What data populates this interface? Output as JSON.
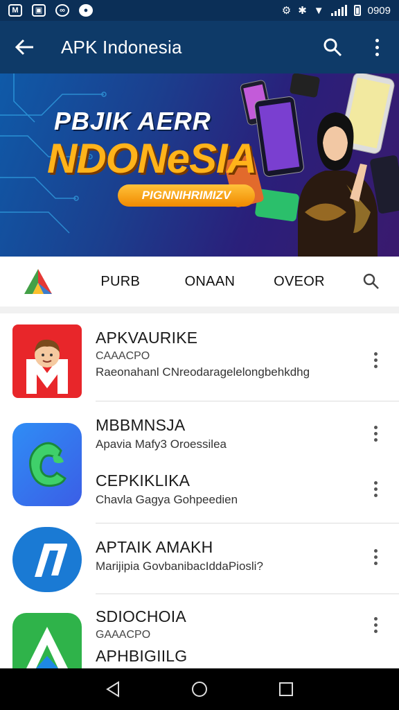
{
  "status_bar": {
    "left_icons": [
      "gmail-icon",
      "sim-icon",
      "message-icon",
      "music-icon"
    ],
    "time": "0909",
    "right_icons": [
      "vibrate-icon",
      "bluetooth-icon",
      "wifi-icon",
      "signal-icon",
      "battery-icon"
    ]
  },
  "app_bar": {
    "title": "APK Indonesia",
    "back_icon": "arrow-left-icon",
    "actions": [
      "search-icon",
      "more-vert-icon"
    ],
    "background": "#0e3a68"
  },
  "banner": {
    "line1": "PBJIK AERR",
    "line2": "NDONeSIA",
    "pill": "PIGNNIHRIMIZV",
    "accent": "#ffb31a"
  },
  "tabs": {
    "items": [
      "PURB",
      "ONAAN",
      "OVEOR"
    ],
    "logo_icon": "play-triangle-logo",
    "search_icon": "search-icon"
  },
  "apps": [
    {
      "title": "APKVAURIKE",
      "line2": "CAAACPO",
      "line3": "Raeonahanl CNreodaragelelongbehkdhg",
      "icon": "red-avatar-m-icon",
      "icon_color": "#e8262a"
    },
    {
      "title": "MBBMNSJA",
      "line2": "Apavia Mafy3 Oroessilea",
      "icon": "green-c-icon",
      "icon_color": "#2f7df0"
    },
    {
      "title": "CEPKIKLIKA",
      "line2": "Chavla Gagya Gohpeedien",
      "icon": "",
      "icon_color": ""
    },
    {
      "title": "APTAIK AMAKH",
      "line2": "Marijipia GovbanibacIddaPiosli?",
      "icon": "blue-n-icon",
      "icon_color": "#1a7ad4"
    },
    {
      "title": "SDIOCHOIA",
      "line2": "GAAACPO",
      "line3": "APHBIGIILG",
      "icon": "green-a-icon",
      "icon_color": "#2fb34a"
    }
  ],
  "nav_bar": {
    "buttons": [
      "back-triangle-icon",
      "home-circle-icon",
      "recents-square-icon"
    ]
  }
}
